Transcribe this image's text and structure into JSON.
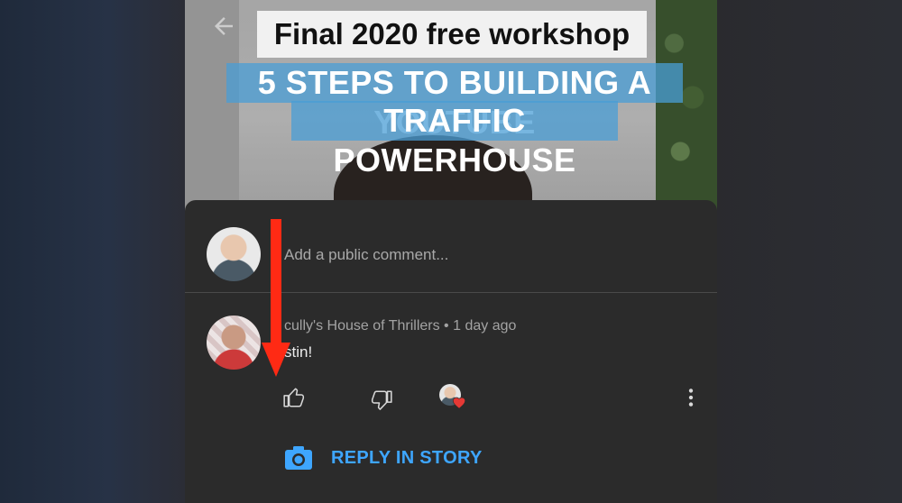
{
  "video": {
    "title_line1": "Final 2020 free workshop",
    "title_line2": "5 STEPS TO BUILDING A YOUTUBE",
    "title_line3": "TRAFFIC POWERHOUSE"
  },
  "comments": {
    "add_comment_placeholder": "Add a public comment...",
    "items": [
      {
        "author": "cully's House of Thrillers",
        "separator": "•",
        "time": "1 day ago",
        "text": "stin!"
      }
    ],
    "reply_in_story_label": "REPLY IN STORY"
  },
  "icons": {
    "back": "back-arrow-icon",
    "like": "thumbs-up-icon",
    "dislike": "thumbs-down-icon",
    "creator_heart": "heart-icon",
    "more": "more-vert-icon",
    "camera": "camera-icon"
  },
  "colors": {
    "accent_blue": "#3ea6ff",
    "heart_red": "#e53935",
    "annotation_arrow": "#ff2a14"
  }
}
